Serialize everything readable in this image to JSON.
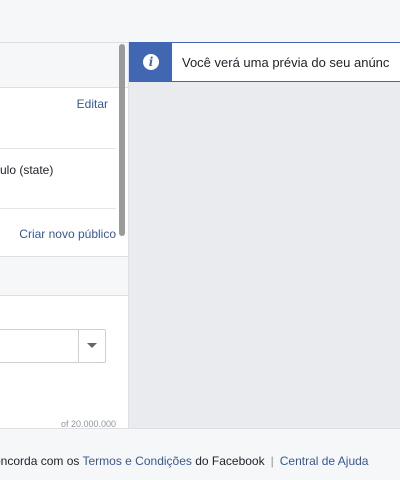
{
  "left_panel": {
    "edit_label": "Editar",
    "state_text": "ulo (state)",
    "new_audience_label": "Criar novo público",
    "count_text": "of 20.000.000"
  },
  "notice": {
    "icon": "info-icon",
    "icon_glyph": "i",
    "text": "Você verá uma prévia do seu anúnc"
  },
  "footer": {
    "prefix": "oncorda com os ",
    "terms_link": "Termos e Condições",
    "middle": " do Facebook",
    "separator": "|",
    "help_link": "Central de Ajuda"
  },
  "colors": {
    "link": "#365899",
    "accent": "#4267b2",
    "preview_bg": "#e9ebee"
  }
}
